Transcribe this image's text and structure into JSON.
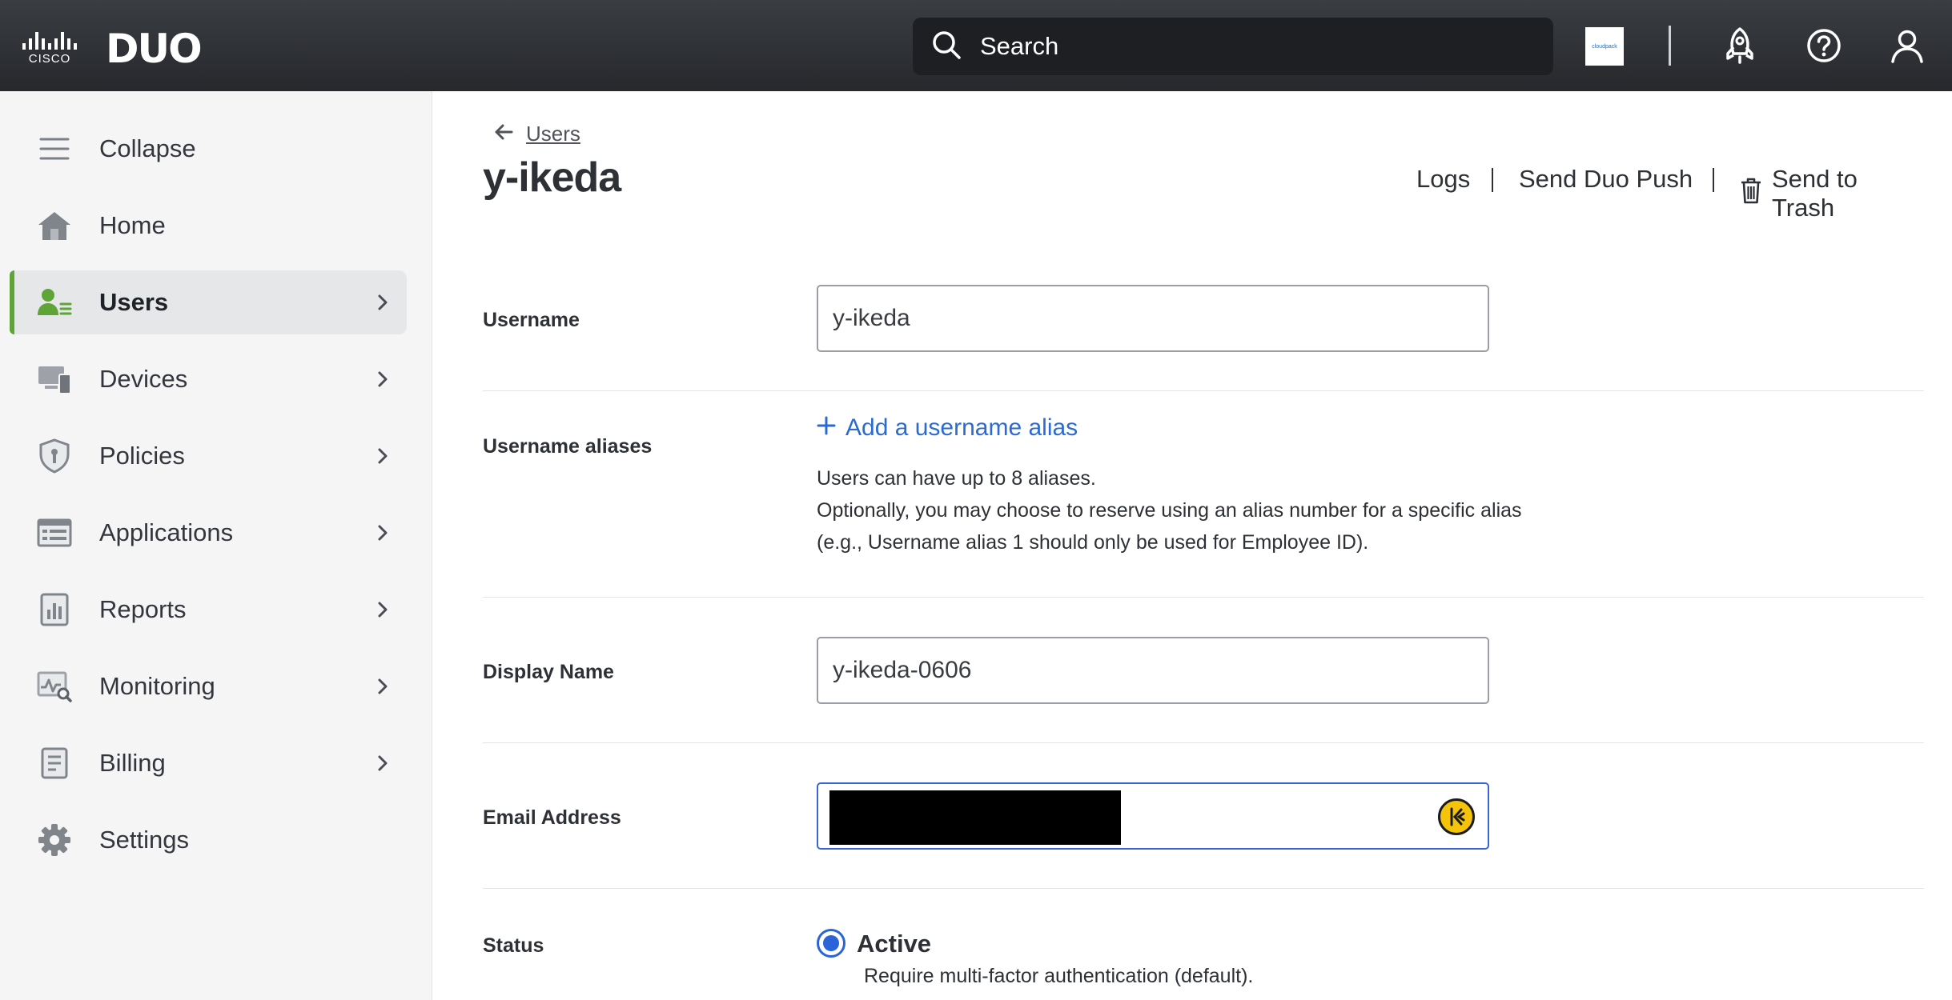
{
  "topbar": {
    "cisco_logo": "CISCO",
    "duo_logo": "DUO",
    "search": {
      "placeholder": "Search",
      "icon": "search-icon"
    },
    "org_logo_text": "cloudpack",
    "icons": [
      "rocket-icon",
      "help-icon",
      "account-icon"
    ]
  },
  "sidebar": {
    "items": [
      {
        "label": "Collapse",
        "icon": "menu-icon",
        "chevron": false,
        "active": false
      },
      {
        "label": "Home",
        "icon": "home-icon",
        "chevron": false,
        "active": false
      },
      {
        "label": "Users",
        "icon": "users-icon",
        "chevron": true,
        "active": true
      },
      {
        "label": "Devices",
        "icon": "devices-icon",
        "chevron": true,
        "active": false
      },
      {
        "label": "Policies",
        "icon": "shield-icon",
        "chevron": true,
        "active": false
      },
      {
        "label": "Applications",
        "icon": "applications-icon",
        "chevron": true,
        "active": false
      },
      {
        "label": "Reports",
        "icon": "reports-icon",
        "chevron": true,
        "active": false
      },
      {
        "label": "Monitoring",
        "icon": "monitoring-icon",
        "chevron": true,
        "active": false
      },
      {
        "label": "Billing",
        "icon": "billing-icon",
        "chevron": true,
        "active": false
      },
      {
        "label": "Settings",
        "icon": "gear-icon",
        "chevron": false,
        "active": false
      }
    ]
  },
  "main": {
    "breadcrumb": "Users",
    "title": "y-ikeda",
    "actions": {
      "logs": "Logs",
      "send_push": "Send Duo Push",
      "trash": "Send to Trash"
    },
    "username": {
      "label": "Username",
      "value": "y-ikeda"
    },
    "aliases": {
      "label": "Username aliases",
      "add_link": "Add a username alias",
      "help_1": "Users can have up to 8 aliases.",
      "help_2": "Optionally, you may choose to reserve using an alias number for a specific alias",
      "help_3": "(e.g., Username alias 1 should only be used for Employee ID)."
    },
    "display_name": {
      "label": "Display Name",
      "value": "y-ikeda-0606"
    },
    "email": {
      "label": "Email Address",
      "value": ""
    },
    "status": {
      "label": "Status",
      "selected": "Active",
      "help": "Require multi-factor authentication (default)."
    }
  },
  "colors": {
    "topbar": "#2a2c30",
    "accent_green": "#5fa437",
    "link_blue": "#2b6bd1",
    "focus_blue": "#3a63d6"
  }
}
